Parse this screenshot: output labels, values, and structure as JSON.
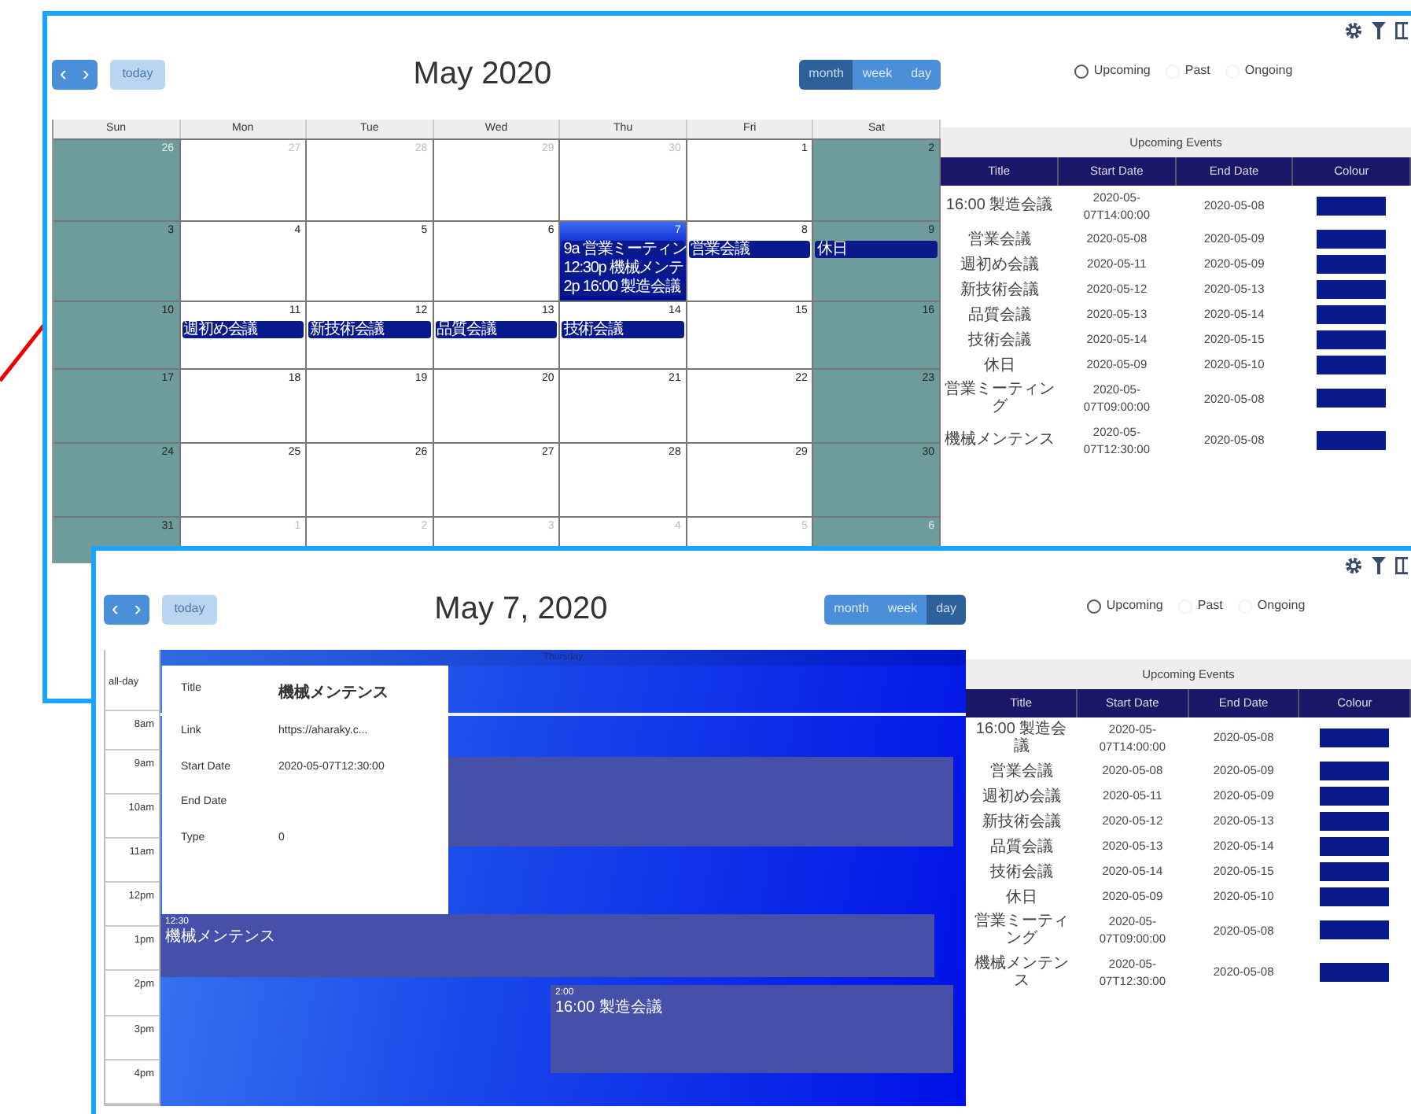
{
  "month_window": {
    "toolbar": {
      "prev": "‹",
      "next": "›",
      "today": "today",
      "title": "May 2020",
      "views": [
        {
          "label": "month",
          "selected": true
        },
        {
          "label": "week",
          "selected": false
        },
        {
          "label": "day",
          "selected": false
        }
      ]
    },
    "weekdays": [
      "Sun",
      "Mon",
      "Tue",
      "Wed",
      "Thu",
      "Fri",
      "Sat"
    ],
    "weeks": [
      [
        {
          "day": "26",
          "other_month": true
        },
        {
          "day": "27",
          "other_month": true
        },
        {
          "day": "28",
          "other_month": true
        },
        {
          "day": "29",
          "other_month": true
        },
        {
          "day": "30",
          "other_month": true
        },
        {
          "day": "1"
        },
        {
          "day": "2"
        }
      ],
      [
        {
          "day": "3"
        },
        {
          "day": "4"
        },
        {
          "day": "5"
        },
        {
          "day": "6"
        },
        {
          "day": "7",
          "today": true,
          "events": [
            "9a 営業ミーティン",
            "12:30p 機械メンテ",
            "2p 16:00 製造会議"
          ]
        },
        {
          "day": "8",
          "events": [
            "営業会議"
          ]
        },
        {
          "day": "9",
          "events": [
            "休日"
          ]
        }
      ],
      [
        {
          "day": "10"
        },
        {
          "day": "11",
          "events": [
            "週初め会議"
          ]
        },
        {
          "day": "12",
          "events": [
            "新技術会議"
          ]
        },
        {
          "day": "13",
          "events": [
            "品質会議"
          ]
        },
        {
          "day": "14",
          "events": [
            "技術会議"
          ]
        },
        {
          "day": "15"
        },
        {
          "day": "16"
        }
      ],
      [
        {
          "day": "17"
        },
        {
          "day": "18"
        },
        {
          "day": "19"
        },
        {
          "day": "20"
        },
        {
          "day": "21"
        },
        {
          "day": "22"
        },
        {
          "day": "23"
        }
      ],
      [
        {
          "day": "24"
        },
        {
          "day": "25"
        },
        {
          "day": "26"
        },
        {
          "day": "27"
        },
        {
          "day": "28"
        },
        {
          "day": "29"
        },
        {
          "day": "30"
        }
      ],
      [
        {
          "day": "31"
        },
        {
          "day": "1",
          "other_month": true
        },
        {
          "day": "2",
          "other_month": true
        },
        {
          "day": "3",
          "other_month": true
        },
        {
          "day": "4",
          "other_month": true
        },
        {
          "day": "5",
          "other_month": true
        },
        {
          "day": "6",
          "other_month": true
        }
      ]
    ],
    "filters": [
      {
        "label": "Upcoming",
        "selected": true
      },
      {
        "label": "Past",
        "selected": false
      },
      {
        "label": "Ongoing",
        "selected": false
      }
    ],
    "table": {
      "caption": "Upcoming Events",
      "columns": [
        "Title",
        "Start Date",
        "End Date",
        "Colour"
      ],
      "rows": [
        {
          "title": "16:00 製造会議",
          "start": "2020-05-07T14:00:00",
          "end": "2020-05-08"
        },
        {
          "title": "営業会議",
          "start": "2020-05-08",
          "end": "2020-05-09"
        },
        {
          "title": "週初め会議",
          "start": "2020-05-11",
          "end": "2020-05-09"
        },
        {
          "title": "新技術会議",
          "start": "2020-05-12",
          "end": "2020-05-13"
        },
        {
          "title": "品質会議",
          "start": "2020-05-13",
          "end": "2020-05-14"
        },
        {
          "title": "技術会議",
          "start": "2020-05-14",
          "end": "2020-05-15"
        },
        {
          "title": "休日",
          "start": "2020-05-09",
          "end": "2020-05-10"
        },
        {
          "title": "営業ミーティング",
          "start": "2020-05-07T09:00:00",
          "end": "2020-05-08"
        },
        {
          "title": "機械メンテンス",
          "start": "2020-05-07T12:30:00",
          "end": "2020-05-08"
        }
      ]
    }
  },
  "day_window": {
    "toolbar": {
      "prev": "‹",
      "next": "›",
      "today": "today",
      "title": "May 7, 2020",
      "views": [
        {
          "label": "month",
          "selected": false
        },
        {
          "label": "week",
          "selected": false
        },
        {
          "label": "day",
          "selected": true
        }
      ]
    },
    "day_header": "Thursday",
    "all_day": "all-day",
    "times": [
      "8am",
      "9am",
      "10am",
      "11am",
      "12pm",
      "1pm",
      "2pm",
      "3pm",
      "4pm"
    ],
    "events": [
      {
        "kind": "morning"
      },
      {
        "kind": "midday",
        "time": "12:30",
        "title": "機械メンテンス"
      },
      {
        "kind": "afternoon",
        "time": "2:00",
        "title": "16:00 製造会議"
      }
    ],
    "popover": [
      {
        "label": "Title",
        "value": "機械メンテンス"
      },
      {
        "label": "Link",
        "value": "https://aharaky.c..."
      },
      {
        "label": "Start Date",
        "value": "2020-05-07T12:30:00"
      },
      {
        "label": "End Date"
      },
      {
        "label": "Type",
        "value": "0"
      }
    ],
    "filters": [
      {
        "label": "Upcoming",
        "selected": true
      },
      {
        "label": "Past",
        "selected": false
      },
      {
        "label": "Ongoing",
        "selected": false
      }
    ],
    "table": {
      "caption": "Upcoming Events",
      "columns": [
        "Title",
        "Start Date",
        "End Date",
        "Colour"
      ],
      "rows": [
        {
          "title": "16:00 製造会議",
          "start": "2020-05-07T14:00:00",
          "end": "2020-05-08"
        },
        {
          "title": "営業会議",
          "start": "2020-05-08",
          "end": "2020-05-09"
        },
        {
          "title": "週初め会議",
          "start": "2020-05-11",
          "end": "2020-05-09"
        },
        {
          "title": "新技術会議",
          "start": "2020-05-12",
          "end": "2020-05-13"
        },
        {
          "title": "品質会議",
          "start": "2020-05-13",
          "end": "2020-05-14"
        },
        {
          "title": "技術会議",
          "start": "2020-05-14",
          "end": "2020-05-15"
        },
        {
          "title": "休日",
          "start": "2020-05-09",
          "end": "2020-05-10"
        },
        {
          "title": "営業ミーティング",
          "start": "2020-05-07T09:00:00",
          "end": "2020-05-08"
        },
        {
          "title": "機械メンテンス",
          "start": "2020-05-07T12:30:00",
          "end": "2020-05-08"
        }
      ]
    }
  }
}
